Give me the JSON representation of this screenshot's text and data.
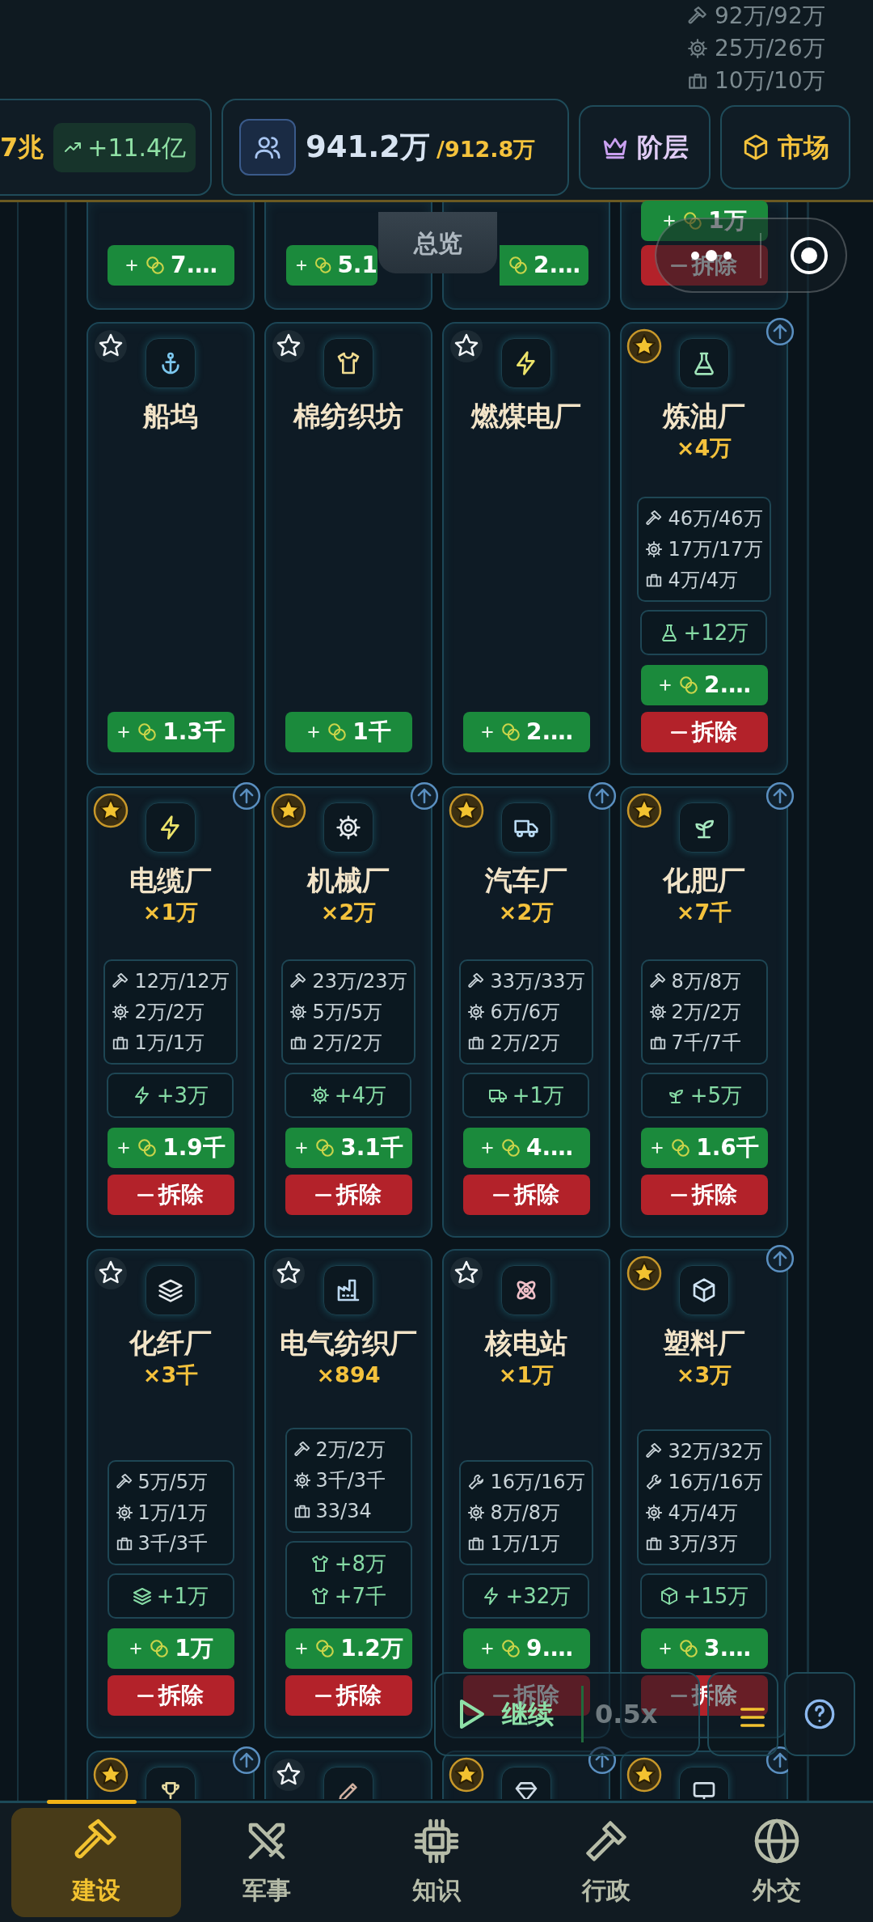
{
  "header": {
    "background_stats": [
      {
        "kind": "hammer",
        "text": "92万/92万"
      },
      {
        "kind": "gear",
        "text": "25万/26万"
      },
      {
        "kind": "worker",
        "text": "10万/10万"
      }
    ],
    "treasury": {
      "value": "7兆",
      "change": "+11.4亿"
    },
    "population": {
      "current": "941.2万",
      "capacity": "/912.8万"
    },
    "buttons": [
      {
        "kind": "crown",
        "label": "阶层"
      },
      {
        "kind": "cube",
        "label": "市场"
      }
    ],
    "overview_tab": "总览"
  },
  "top_row_partial": [
    {
      "build": "7.…"
    },
    {
      "build": "5.1"
    },
    {
      "build": "2.…"
    },
    {
      "build": "1万",
      "demolish": "拆除"
    }
  ],
  "buildings": [
    {
      "name": "船坞",
      "kind": "anchor",
      "favorite": false,
      "upgradable": false,
      "build": "1.3千"
    },
    {
      "name": "棉纺织坊",
      "kind": "shirt",
      "favorite": false,
      "upgradable": false,
      "build": "1千"
    },
    {
      "name": "燃煤电厂",
      "kind": "bolt",
      "favorite": false,
      "upgradable": false,
      "build": "2.…"
    },
    {
      "name": "炼油厂",
      "kind": "flask",
      "favorite": true,
      "upgradable": true,
      "count": "×4万",
      "stats": [
        {
          "kind": "hammer",
          "text": "46万/46万"
        },
        {
          "kind": "gear",
          "text": "17万/17万"
        },
        {
          "kind": "worker",
          "text": "4万/4万"
        }
      ],
      "outputs": [
        {
          "kind": "flask",
          "text": "+12万"
        }
      ],
      "build": "2.…",
      "demolish": "拆除"
    },
    {
      "name": "电缆厂",
      "kind": "bolt",
      "favorite": true,
      "upgradable": true,
      "count": "×1万",
      "stats": [
        {
          "kind": "hammer",
          "text": "12万/12万"
        },
        {
          "kind": "gear",
          "text": "2万/2万"
        },
        {
          "kind": "worker",
          "text": "1万/1万"
        }
      ],
      "outputs": [
        {
          "kind": "bolt",
          "text": "+3万"
        }
      ],
      "build": "1.9千",
      "demolish": "拆除"
    },
    {
      "name": "机械厂",
      "kind": "gear",
      "favorite": true,
      "upgradable": true,
      "count": "×2万",
      "stats": [
        {
          "kind": "hammer",
          "text": "23万/23万"
        },
        {
          "kind": "gear",
          "text": "5万/5万"
        },
        {
          "kind": "worker",
          "text": "2万/2万"
        }
      ],
      "outputs": [
        {
          "kind": "gear",
          "text": "+4万"
        }
      ],
      "build": "3.1千",
      "demolish": "拆除"
    },
    {
      "name": "汽车厂",
      "kind": "truck",
      "favorite": true,
      "upgradable": true,
      "count": "×2万",
      "stats": [
        {
          "kind": "hammer",
          "text": "33万/33万"
        },
        {
          "kind": "gear",
          "text": "6万/6万"
        },
        {
          "kind": "worker",
          "text": "2万/2万"
        }
      ],
      "outputs": [
        {
          "kind": "truck",
          "text": "+1万"
        }
      ],
      "build": "4.…",
      "demolish": "拆除"
    },
    {
      "name": "化肥厂",
      "kind": "sprout",
      "favorite": true,
      "upgradable": true,
      "count": "×7千",
      "stats": [
        {
          "kind": "hammer",
          "text": "8万/8万"
        },
        {
          "kind": "gear",
          "text": "2万/2万"
        },
        {
          "kind": "worker",
          "text": "7千/7千"
        }
      ],
      "outputs": [
        {
          "kind": "sprout",
          "text": "+5万"
        }
      ],
      "build": "1.6千",
      "demolish": "拆除"
    },
    {
      "name": "化纤厂",
      "kind": "layers",
      "favorite": false,
      "upgradable": false,
      "count": "×3千",
      "stats": [
        {
          "kind": "hammer",
          "text": "5万/5万"
        },
        {
          "kind": "gear",
          "text": "1万/1万"
        },
        {
          "kind": "worker",
          "text": "3千/3千"
        }
      ],
      "outputs": [
        {
          "kind": "layers",
          "text": "+1万"
        }
      ],
      "build": "1万",
      "demolish": "拆除"
    },
    {
      "name": "电气纺织厂",
      "kind": "factory",
      "favorite": false,
      "upgradable": false,
      "count": "×894",
      "stats": [
        {
          "kind": "hammer",
          "text": "2万/2万"
        },
        {
          "kind": "gear",
          "text": "3千/3千"
        },
        {
          "kind": "worker",
          "text": "33/34"
        }
      ],
      "outputs": [
        {
          "kind": "shirt",
          "text": "+8万"
        },
        {
          "kind": "shirt",
          "text": "+7千"
        }
      ],
      "build": "1.2万",
      "demolish": "拆除"
    },
    {
      "name": "核电站",
      "kind": "atom",
      "favorite": false,
      "upgradable": false,
      "count": "×1万",
      "stats": [
        {
          "kind": "wrench",
          "text": "16万/16万"
        },
        {
          "kind": "gear",
          "text": "8万/8万"
        },
        {
          "kind": "worker",
          "text": "1万/1万"
        }
      ],
      "outputs": [
        {
          "kind": "bolt",
          "text": "+32万"
        }
      ],
      "build": "9.…",
      "demolish": "拆除"
    },
    {
      "name": "塑料厂",
      "kind": "cube",
      "favorite": true,
      "upgradable": true,
      "count": "×3万",
      "stats": [
        {
          "kind": "hammer",
          "text": "32万/32万"
        },
        {
          "kind": "wrench",
          "text": "16万/16万"
        },
        {
          "kind": "gear",
          "text": "4万/4万"
        },
        {
          "kind": "worker",
          "text": "3万/3万"
        }
      ],
      "outputs": [
        {
          "kind": "cube",
          "text": "+15万"
        }
      ],
      "build": "3.…",
      "demolish": "拆除"
    }
  ],
  "bottom_row_partial": [
    {
      "kind": "trophy",
      "favorite": true,
      "upgradable": true
    },
    {
      "kind": "pen",
      "favorite": false,
      "upgradable": false
    },
    {
      "kind": "gem",
      "favorite": true,
      "upgradable": true
    },
    {
      "kind": "monitor",
      "favorite": true,
      "upgradable": true
    }
  ],
  "controls": {
    "resume": "继续",
    "speed": "0.5x"
  },
  "nav": [
    {
      "kind": "hammer",
      "label": "建设",
      "selected": true
    },
    {
      "kind": "swords",
      "label": "军事",
      "selected": false
    },
    {
      "kind": "chip",
      "label": "知识",
      "selected": false
    },
    {
      "kind": "gavel",
      "label": "行政",
      "selected": false
    },
    {
      "kind": "globe",
      "label": "外交",
      "selected": false
    }
  ]
}
